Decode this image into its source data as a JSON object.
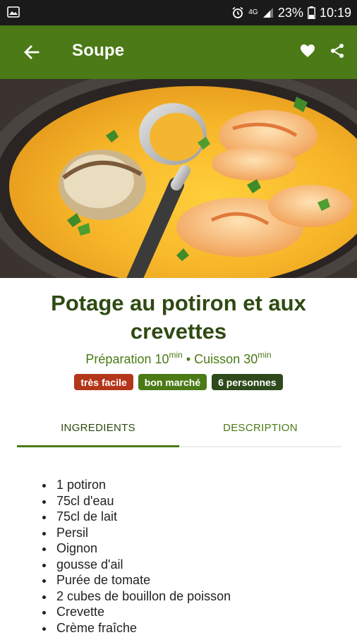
{
  "status_bar": {
    "network": "4G",
    "battery": "23%",
    "time": "10:19"
  },
  "app_bar": {
    "title": "Soupe"
  },
  "recipe": {
    "title": "Potage au potiron et aux crevettes",
    "prep_label": "Préparation 10",
    "prep_unit": "min",
    "separator": " • ",
    "cook_label": "Cuisson 30",
    "cook_unit": "min",
    "badges": [
      "très facile",
      "bon marché",
      "6 personnes"
    ]
  },
  "tabs": [
    {
      "label": "INGREDIENTS"
    },
    {
      "label": "DESCRIPTION"
    }
  ],
  "ingredients": [
    "1 potiron",
    "75cl d'eau",
    "75cl de lait",
    "Persil",
    "Oignon",
    "gousse d'ail",
    "Purée de tomate",
    "2 cubes de bouillon de poisson",
    "Crevette",
    "Crème fraîche"
  ],
  "colors": {
    "primary": "#4b7a16",
    "title": "#2f4a12",
    "badge_easy": "#b3361b",
    "badge_cheap": "#4b7a16",
    "badge_people": "#2e4a1c"
  },
  "icons": {
    "back": "arrow-left-icon",
    "favorite": "heart-icon",
    "share": "share-icon"
  }
}
